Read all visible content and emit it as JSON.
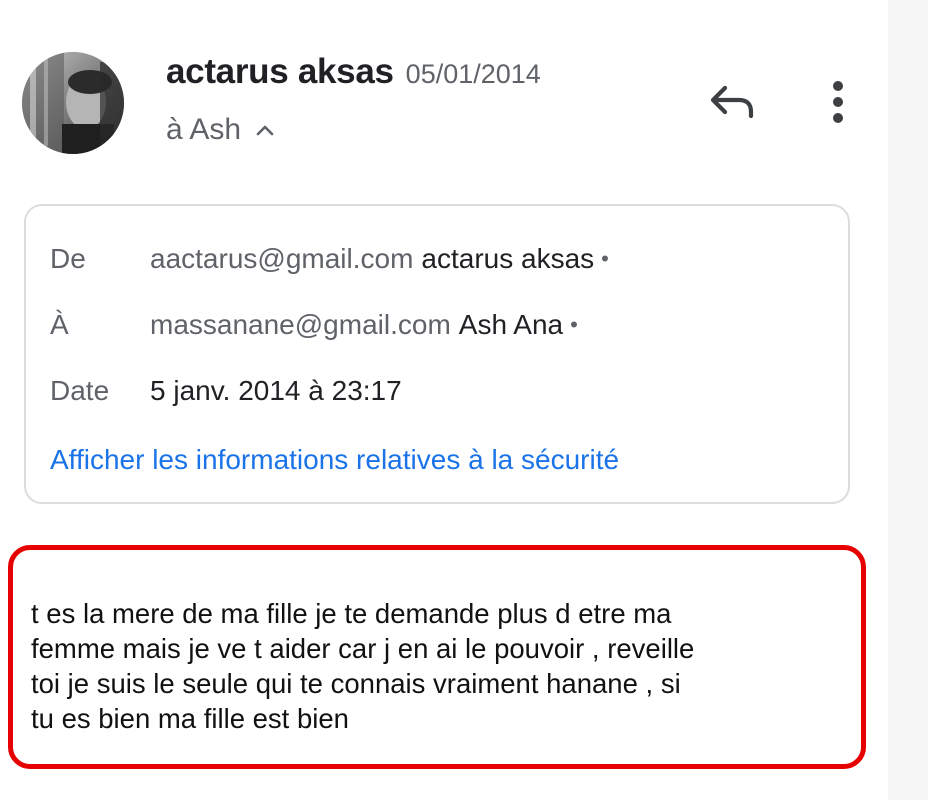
{
  "header": {
    "sender_name": "actarus aksas",
    "date_short": "05/01/2014",
    "recipient_summary": "à Ash",
    "icons": {
      "avatar": "avatar-photo",
      "expand": "chevron-up-icon",
      "reply": "reply-arrow-icon",
      "more": "more-vertical-icon"
    }
  },
  "details": {
    "from_label": "De",
    "from_email": "aactarus@gmail.com",
    "from_name": "actarus aksas",
    "to_label": "À",
    "to_email": "massanane@gmail.com",
    "to_name": "Ash Ana",
    "separator": "•",
    "date_label": "Date",
    "date_value": "5 janv. 2014 à 23:17",
    "security_link": "Afficher les informations relatives à la sécurité"
  },
  "message": {
    "lines": [
      "t es la mere de ma fille je te demande plus d etre ma",
      "femme mais je ve t aider car j en ai le pouvoir , reveille",
      "toi je suis le seule qui te connais vraiment hanane , si",
      "tu es bien ma fille est bien"
    ]
  },
  "colors": {
    "link": "#1a73e8",
    "highlight_border": "#e60000",
    "secondary_text": "#5f6368",
    "card_border": "#dadce0"
  }
}
